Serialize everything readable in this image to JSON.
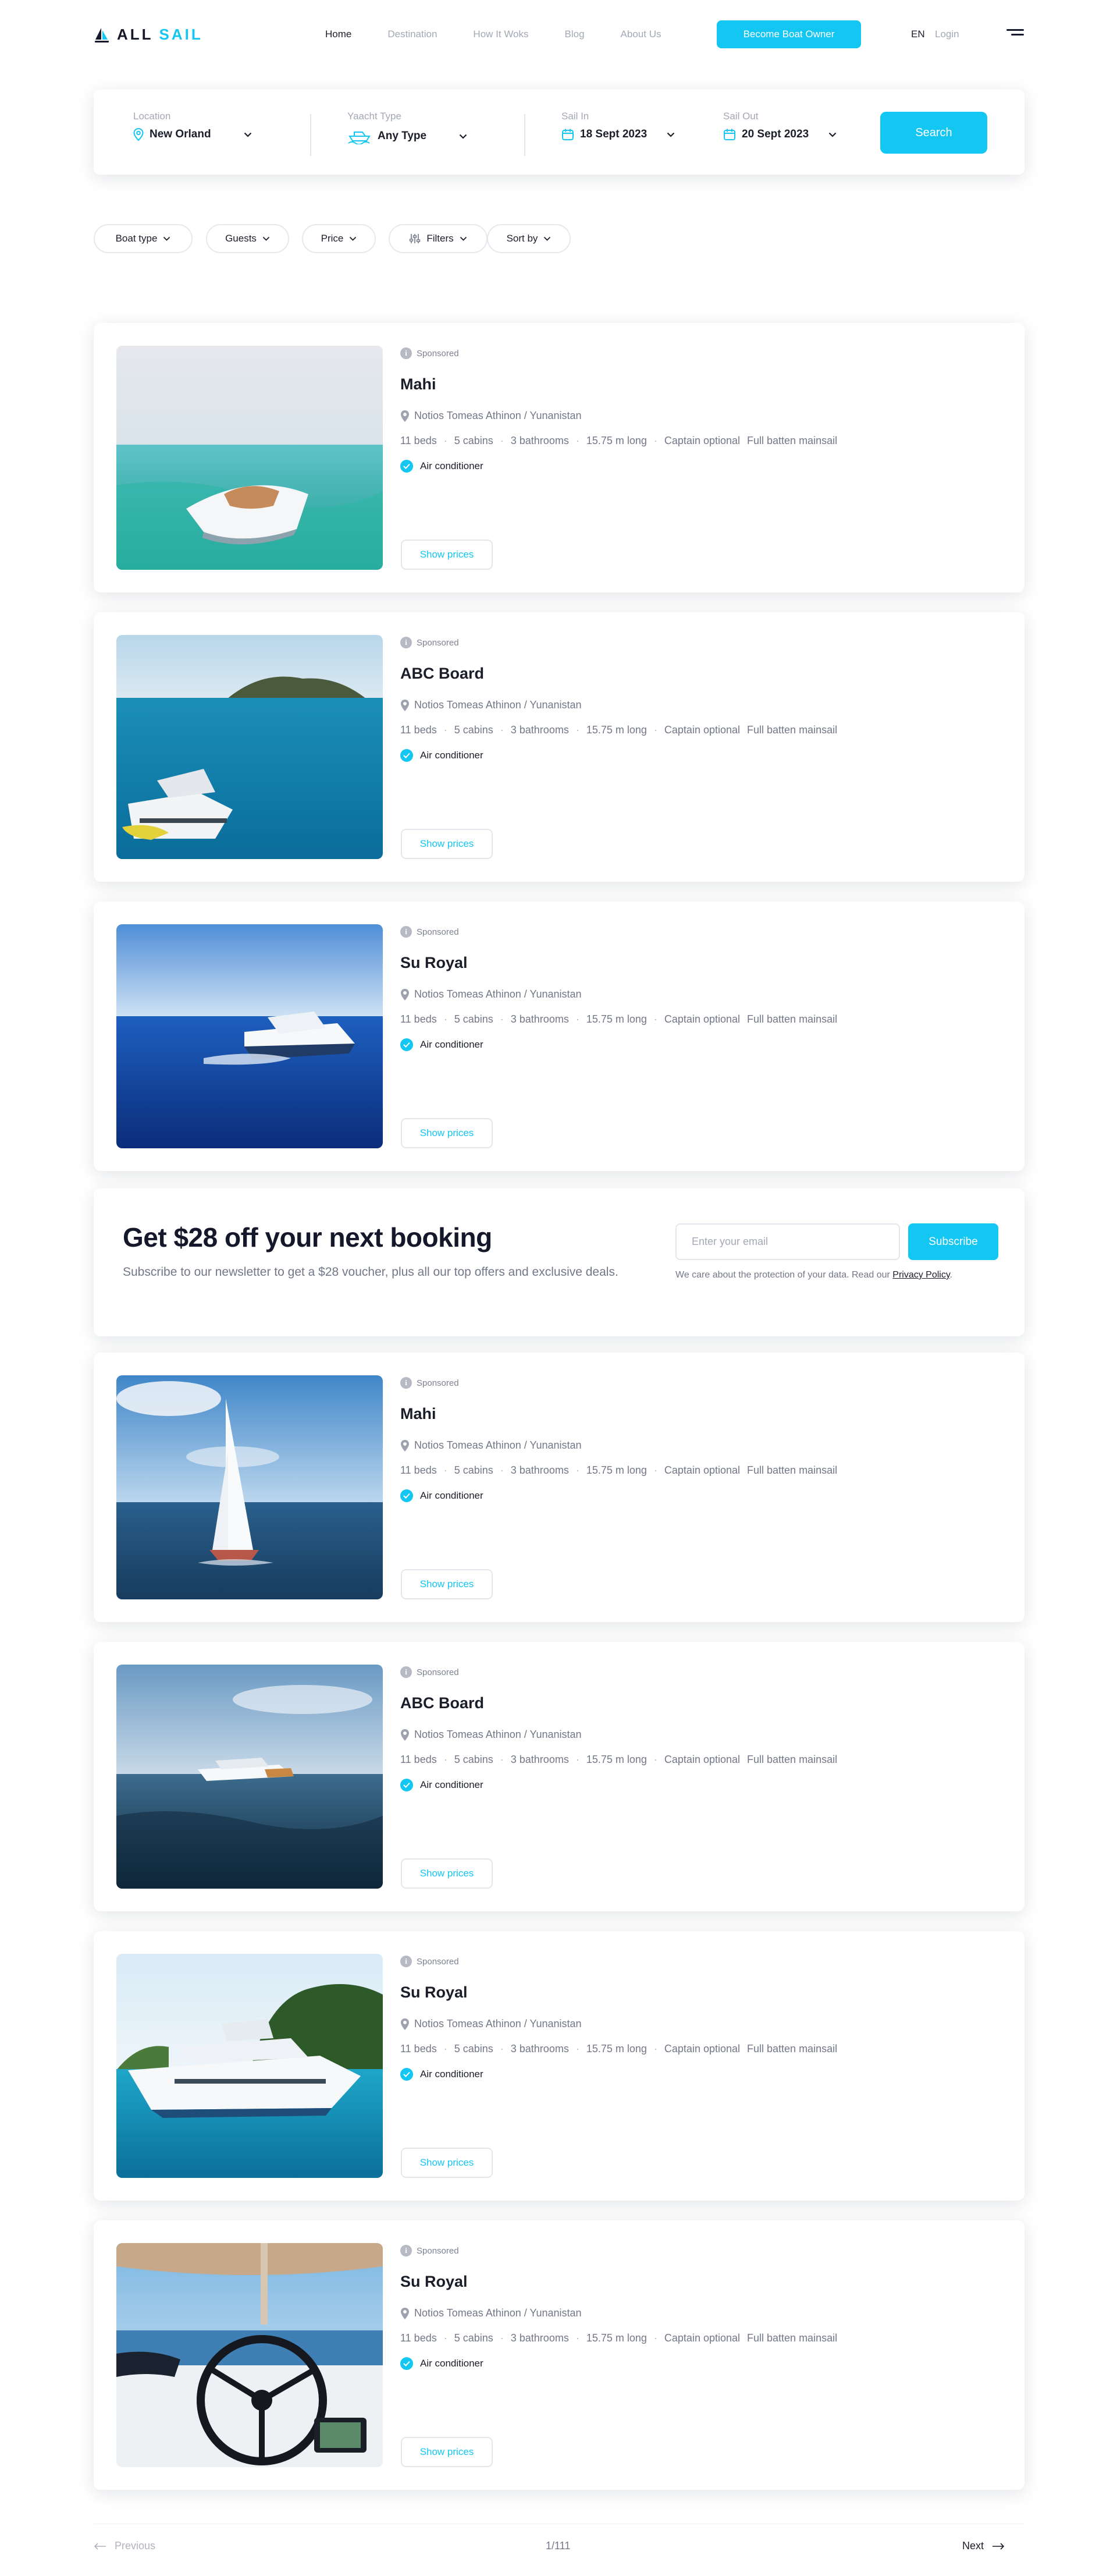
{
  "brand": {
    "name_part1": "ALL",
    "name_part2": "SAIL",
    "accent": "#14c6f2",
    "dark": "#15182a"
  },
  "nav": {
    "items": [
      {
        "label": "Home",
        "active": true
      },
      {
        "label": "Destination",
        "active": false
      },
      {
        "label": "How It Woks",
        "active": false
      },
      {
        "label": "Blog",
        "active": false
      },
      {
        "label": "About Us",
        "active": false
      }
    ],
    "owner_button": "Become Boat Owner",
    "language": "EN",
    "login": "Login",
    "menu_icon": "hamburger-icon"
  },
  "search": {
    "location": {
      "label": "Location",
      "value": "New Orland",
      "icon": "map-pin-icon"
    },
    "yacht_type": {
      "label": "Yaacht Type",
      "value": "Any Type",
      "icon": "boat-icon"
    },
    "sail_in": {
      "label": "Sail In",
      "value": "18 Sept 2023",
      "icon": "calendar-icon"
    },
    "sail_out": {
      "label": "Sail Out",
      "value": "20 Sept 2023",
      "icon": "calendar-icon"
    },
    "button": "Search"
  },
  "filters": [
    {
      "label": "Boat type"
    },
    {
      "label": "Guests"
    },
    {
      "label": "Price"
    },
    {
      "label": "Filters",
      "icon": "sliders-icon"
    },
    {
      "label": "Sort by"
    }
  ],
  "listings": [
    {
      "sponsored": "Sponsored",
      "name": "Mahi",
      "location": "Notios Tomeas Athinon / Yunanistan",
      "beds": "11 beds",
      "cabins": "5 cabins",
      "bathrooms": "3 bathrooms",
      "length": "15.75 m long",
      "captain": "Captain optional",
      "mainsail": "Full batten mainsail",
      "amenity": "Air conditioner",
      "button": "Show prices"
    },
    {
      "sponsored": "Sponsored",
      "name": "ABC Board",
      "location": "Notios Tomeas Athinon / Yunanistan",
      "beds": "11 beds",
      "cabins": "5 cabins",
      "bathrooms": "3 bathrooms",
      "length": "15.75 m long",
      "captain": "Captain optional",
      "mainsail": "Full batten mainsail",
      "amenity": "Air conditioner",
      "button": "Show prices"
    },
    {
      "sponsored": "Sponsored",
      "name": "Su Royal",
      "location": "Notios Tomeas Athinon / Yunanistan",
      "beds": "11 beds",
      "cabins": "5 cabins",
      "bathrooms": "3 bathrooms",
      "length": "15.75 m long",
      "captain": "Captain optional",
      "mainsail": "Full batten mainsail",
      "amenity": "Air conditioner",
      "button": "Show prices"
    },
    {
      "sponsored": "Sponsored",
      "name": "Mahi",
      "location": "Notios Tomeas Athinon / Yunanistan",
      "beds": "11 beds",
      "cabins": "5 cabins",
      "bathrooms": "3 bathrooms",
      "length": "15.75 m long",
      "captain": "Captain optional",
      "mainsail": "Full batten mainsail",
      "amenity": "Air conditioner",
      "button": "Show prices"
    },
    {
      "sponsored": "Sponsored",
      "name": "ABC Board",
      "location": "Notios Tomeas Athinon / Yunanistan",
      "beds": "11 beds",
      "cabins": "5 cabins",
      "bathrooms": "3 bathrooms",
      "length": "15.75 m long",
      "captain": "Captain optional",
      "mainsail": "Full batten mainsail",
      "amenity": "Air conditioner",
      "button": "Show prices"
    },
    {
      "sponsored": "Sponsored",
      "name": "Su Royal",
      "location": "Notios Tomeas Athinon / Yunanistan",
      "beds": "11 beds",
      "cabins": "5 cabins",
      "bathrooms": "3 bathrooms",
      "length": "15.75 m long",
      "captain": "Captain optional",
      "mainsail": "Full batten mainsail",
      "amenity": "Air conditioner",
      "button": "Show prices"
    },
    {
      "sponsored": "Sponsored",
      "name": "Su Royal",
      "location": "Notios Tomeas Athinon / Yunanistan",
      "beds": "11 beds",
      "cabins": "5 cabins",
      "bathrooms": "3 bathrooms",
      "length": "15.75 m long",
      "captain": "Captain optional",
      "mainsail": "Full batten mainsail",
      "amenity": "Air conditioner",
      "button": "Show prices"
    }
  ],
  "newsletter": {
    "title": "Get $28 off your next booking",
    "text": "Subscribe to our newsletter to get a $28 voucher, plus all our top offers and exclusive deals.",
    "placeholder": "Enter your email",
    "button": "Subscribe",
    "note": "We care about the protection of your data. Read our",
    "policy_link": "Privacy Policy"
  },
  "pagination": {
    "previous": "Previous",
    "count": "1/111",
    "next": "Next"
  }
}
